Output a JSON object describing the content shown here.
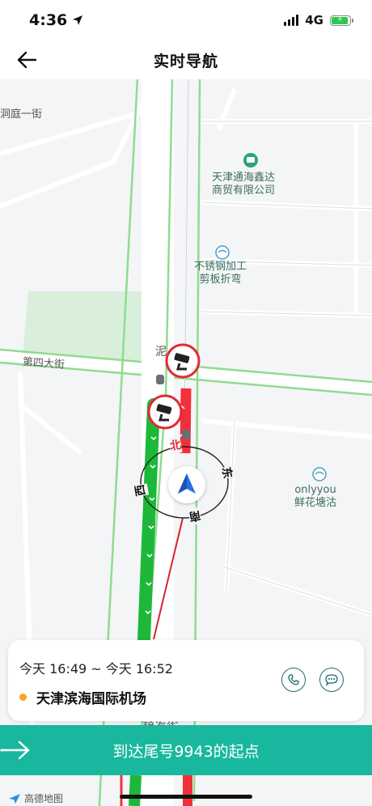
{
  "status": {
    "time": "4:36",
    "network": "4G"
  },
  "nav": {
    "title": "实时导航"
  },
  "map": {
    "labels": {
      "street1": "洞庭一街",
      "street2": "第四大街",
      "poi1": "天津通海鑫达\n商贸有限公司",
      "poi2": "不锈钢加工\n剪板折弯",
      "poi3": "onlyyou\n鲜花塘沽",
      "road_partial": "泥",
      "bottom_partial": "碧海街"
    },
    "compass": {
      "north": "北",
      "east": "东",
      "south": "南",
      "west": "西"
    }
  },
  "trip": {
    "eta": "今天 16:49 ~ 今天 16:52",
    "destination": "天津滨海国际机场"
  },
  "banner": {
    "text": "到达尾号9943的起点"
  },
  "footer": {
    "logo_text": "高德地图"
  },
  "colors": {
    "accent": "#19b89e",
    "route_green": "#1db83a",
    "route_red": "#f2303a"
  }
}
